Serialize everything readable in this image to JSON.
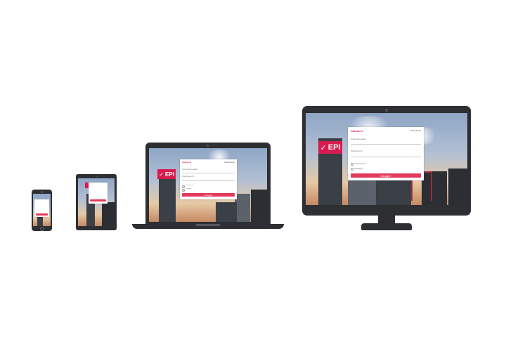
{
  "brand": {
    "logo_text": "EPI",
    "accent": "#d81b4e",
    "button_color": "#e23a5c"
  },
  "login_form": {
    "app_title": "Ciasas.nl",
    "language": "Nederlands",
    "field_user": "Gebruikersnaam",
    "field_password": "Wachtwoord",
    "option_1": "Onthoud mij",
    "option_2": "Uitloggen",
    "submit_label": "Inloggen"
  },
  "devices": [
    "phone",
    "tablet",
    "laptop",
    "desktop"
  ]
}
